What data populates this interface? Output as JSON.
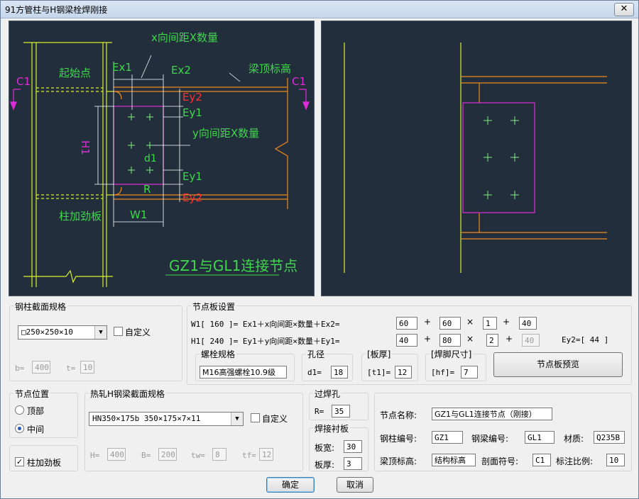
{
  "window": {
    "title": "91方管柱与H钢梁栓焊刚接",
    "close_glyph": "✕"
  },
  "drawing": {
    "start_point": "起始点",
    "x_spacing": "x向间距X数量",
    "ex1": "Ex1",
    "ex2": "Ex2",
    "beam_top_elev": "梁顶标高",
    "c1": "C1",
    "ey2_top": "Ey2",
    "ey1_top": "Ey1",
    "y_spacing": "y向间距X数量",
    "h1": "H1",
    "d1": "d1",
    "ey1_bot": "Ey1",
    "r": "R",
    "ey2_bot": "Ey2",
    "stiffener": "柱加劲板",
    "w1": "W1",
    "caption": "GZ1与GL1连接节点"
  },
  "column_section": {
    "label": "钢柱截面规格",
    "selected": "□250×250×10",
    "custom_label": "自定义",
    "custom_checked": false,
    "b_label": "b=",
    "b_value": "400",
    "t_label": "t=",
    "t_value": "10"
  },
  "gusset": {
    "label": "节点板设置",
    "w1_text": "W1[   160   ]= Ex1＋x向间距×数量＋Ex2=",
    "h1_text": "H1[   240   ]= Ey1＋y向间距×数量＋Ey1=",
    "w_ex1": "60",
    "w_spacing": "60",
    "w_count": "1",
    "w_ex2": "40",
    "h_ey1": "40",
    "h_spacing": "80",
    "h_count": "2",
    "h_ey1b": "40",
    "ey2_text": "Ey2=[   44   ]",
    "plus": "+",
    "times": "×",
    "bolt_label": "螺栓规格",
    "bolt_value": "M16高强螺栓10.9级",
    "hole_label": "孔径",
    "d1_label": "d1=",
    "d1_value": "18",
    "thick_label": "[板厚]",
    "t1_label": "[t1]=",
    "t1_value": "12",
    "weld_label": "[焊脚尺寸]",
    "hf_label": "[hf]=",
    "hf_value": "7",
    "preview_button": "节点板预览"
  },
  "position": {
    "label": "节点位置",
    "options": [
      "顶部",
      "中间"
    ],
    "selected": "中间"
  },
  "stiffener_check": {
    "label": "柱加劲板",
    "checked": true
  },
  "beam_section": {
    "label": "热轧H钢梁截面规格",
    "selected": "HN350×175b    350×175×7×11",
    "custom_label": "自定义",
    "custom_checked": false,
    "h_label": "H=",
    "h_value": "400",
    "b_label": "B=",
    "b_value": "200",
    "tw_label": "tw=",
    "tw_value": "8",
    "tf_label": "tf=",
    "tf_value": "12"
  },
  "weld_hole": {
    "label": "过焊孔",
    "r_label": "R=",
    "r_value": "35"
  },
  "backing": {
    "label": "焊接衬板",
    "width_label": "板宽:",
    "width_value": "30",
    "thick_label": "板厚:",
    "thick_value": "3"
  },
  "node_info": {
    "name_label": "节点名称:",
    "name_value": "GZ1与GL1连接节点（刚接）",
    "col_label": "钢柱编号:",
    "col_value": "GZ1",
    "beam_label": "钢梁编号:",
    "beam_value": "GL1",
    "mat_label": "材质:",
    "mat_value": "Q235B",
    "elev_label": "梁顶标高:",
    "elev_value": "结构标高",
    "sect_label": "剖面符号:",
    "sect_value": "C1",
    "scale_label": "标注比例:",
    "scale_value": "10"
  },
  "buttons": {
    "ok": "确定",
    "cancel": "取消"
  },
  "colors": {
    "canvas_bg": "#222e3c",
    "column": "#d8f02a",
    "beam": "#f08a1e",
    "plate": "#e02cd8",
    "dim": "#ffffff",
    "label_green": "#3ed84a",
    "label_red": "#ff3030",
    "bolt": "#7ef07e"
  }
}
